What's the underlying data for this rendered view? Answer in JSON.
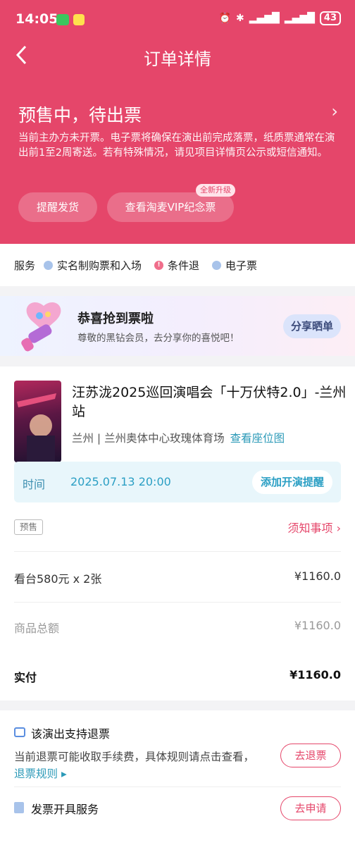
{
  "status_bar": {
    "time": "14:05",
    "battery": "43"
  },
  "nav": {
    "title": "订单详情"
  },
  "order_status": {
    "title": "预售中，待出票",
    "description": "当前主办方未开票。电子票将确保在演出前完成落票，纸质票通常在演出前1至2周寄送。若有特殊情况，请见项目详情页公示或短信通知。",
    "remind_button": "提醒发货",
    "vip_button": "查看淘麦VIP纪念票",
    "vip_badge": "全新升级"
  },
  "services": {
    "label": "服务",
    "items": [
      "实名制购票和入场",
      "条件退",
      "电子票"
    ]
  },
  "banner": {
    "title": "恭喜抢到票啦",
    "subtitle": "尊敬的黑钻会员，去分享你的喜悦吧！",
    "share_button": "分享晒单"
  },
  "show": {
    "title": "汪苏泷2025巡回演唱会「十万伏特2.0」-兰州站",
    "venue": "兰州 | 兰州奥体中心玫瑰体育场",
    "seat_map_link": "查看座位图",
    "time_label": "时间",
    "time_value": "2025.07.13 20:00",
    "add_reminder_button": "添加开演提醒",
    "presale_tag": "预售",
    "notice_link": "须知事项"
  },
  "price": {
    "ticket_line": "看台580元 x 2张",
    "ticket_amount": "¥1160.0",
    "subtotal_label": "商品总额",
    "subtotal_amount": "¥1160.0",
    "paid_label": "实付",
    "paid_amount": "¥1160.0"
  },
  "refund": {
    "title": "该演出支持退票",
    "description": "当前退票可能收取手续费，具体规则请点击查看，",
    "rule_link": "退票规则",
    "button": "去退票"
  },
  "invoice": {
    "title": "发票开具服务",
    "button": "去申请"
  },
  "colors": {
    "brand": "#e5466a",
    "link": "#2c9ab8",
    "time_bg": "#e8f6fb"
  }
}
